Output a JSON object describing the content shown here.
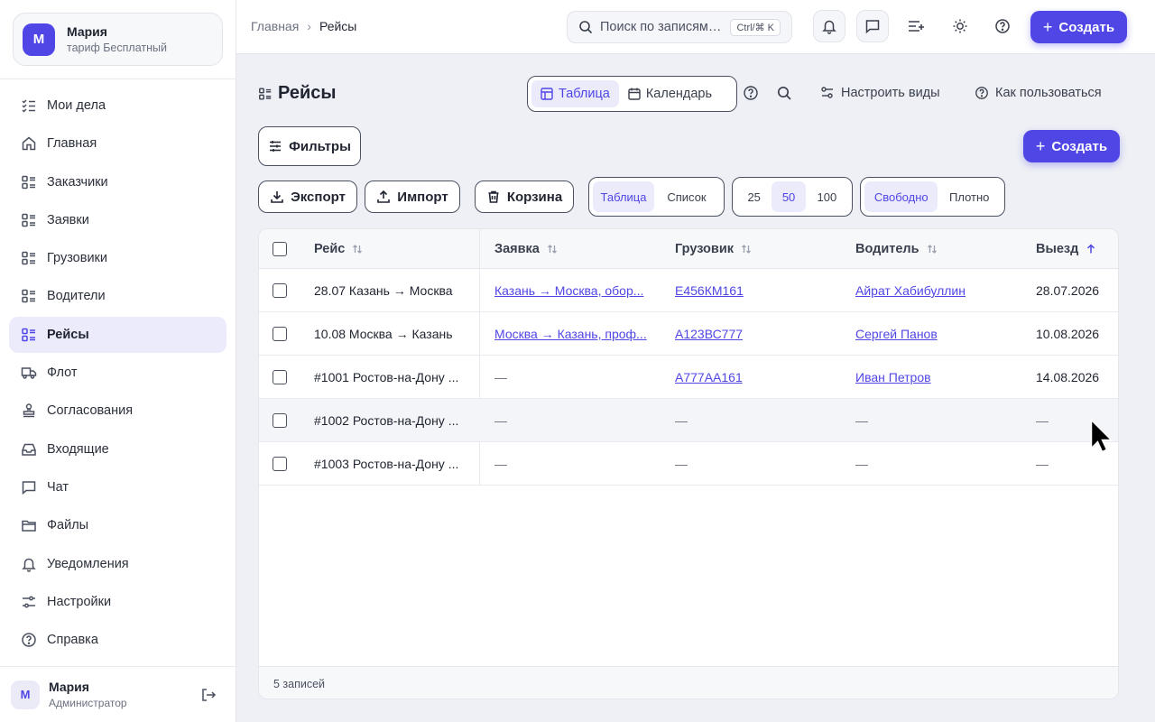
{
  "workspace": {
    "avatar_letter": "М",
    "name": "Мария",
    "plan": "тариф Бесплатный"
  },
  "sidebar": {
    "items": [
      {
        "label": "Мои дела",
        "icon": "checklist-icon"
      },
      {
        "label": "Главная",
        "icon": "home-icon"
      },
      {
        "label": "Заказчики",
        "icon": "list-icon"
      },
      {
        "label": "Заявки",
        "icon": "list-icon"
      },
      {
        "label": "Грузовики",
        "icon": "list-icon"
      },
      {
        "label": "Водители",
        "icon": "list-icon"
      },
      {
        "label": "Рейсы",
        "icon": "list-icon",
        "active": true
      },
      {
        "label": "Флот",
        "icon": "truck-icon"
      },
      {
        "label": "Согласования",
        "icon": "stamp-icon"
      },
      {
        "label": "Входящие",
        "icon": "inbox-icon"
      },
      {
        "label": "Чат",
        "icon": "chat-icon"
      },
      {
        "label": "Файлы",
        "icon": "folder-icon"
      },
      {
        "label": "Уведомления",
        "icon": "bell-icon"
      },
      {
        "label": "Настройки",
        "icon": "settings-icon"
      },
      {
        "label": "Справка",
        "icon": "help-icon"
      }
    ]
  },
  "user": {
    "avatar_letter": "М",
    "name": "Мария",
    "role": "Администратор"
  },
  "topbar": {
    "breadcrumb": [
      "Главная",
      "Рейсы"
    ],
    "search_placeholder": "Поиск по записям…",
    "search_shortcut": "Ctrl/⌘ K",
    "create_label": "Создать"
  },
  "page": {
    "title": "Рейсы",
    "views": [
      {
        "label": "Таблица",
        "active": true
      },
      {
        "label": "Календарь",
        "active": false
      }
    ],
    "configure_views": "Настроить виды",
    "how_to_use": "Как пользоваться",
    "filters_label": "Фильтры",
    "create_label": "Создать",
    "export_label": "Экспорт",
    "import_label": "Импорт",
    "trash_label": "Корзина",
    "display_modes": [
      {
        "label": "Таблица",
        "active": true
      },
      {
        "label": "Список",
        "active": false
      }
    ],
    "page_sizes": [
      {
        "label": "25",
        "active": false
      },
      {
        "label": "50",
        "active": true
      },
      {
        "label": "100",
        "active": false
      }
    ],
    "densities": [
      {
        "label": "Свободно",
        "active": true
      },
      {
        "label": "Плотно",
        "active": false
      }
    ]
  },
  "table": {
    "columns": [
      {
        "label": "Рейс",
        "sort": "none"
      },
      {
        "label": "Заявка",
        "sort": "none"
      },
      {
        "label": "Грузовик",
        "sort": "none"
      },
      {
        "label": "Водитель",
        "sort": "none"
      },
      {
        "label": "Выезд",
        "sort": "asc"
      }
    ],
    "rows": [
      {
        "trip": "28.07 Казань → Москва",
        "order": "Казань → Москва, обор...",
        "truck": "Е456КМ161",
        "driver": "Айрат Хабибуллин",
        "departure": "28.07.2026"
      },
      {
        "trip": "10.08 Москва → Казань",
        "order": "Москва → Казань, проф...",
        "truck": "А123ВС777",
        "driver": "Сергей Панов",
        "departure": "10.08.2026"
      },
      {
        "trip": "#1001 Ростов-на-Дону ...",
        "order": "—",
        "truck": "А777АА161",
        "driver": "Иван Петров",
        "departure": "14.08.2026"
      },
      {
        "trip": "#1002 Ростов-на-Дону ...",
        "order": "—",
        "truck": "—",
        "driver": "—",
        "departure": "—"
      },
      {
        "trip": "#1003 Ростов-на-Дону ...",
        "order": "—",
        "truck": "—",
        "driver": "—",
        "departure": "—"
      }
    ],
    "footer": "5 записей"
  },
  "colors": {
    "accent": "#4f46e5",
    "accent_soft": "#ebebfb"
  }
}
